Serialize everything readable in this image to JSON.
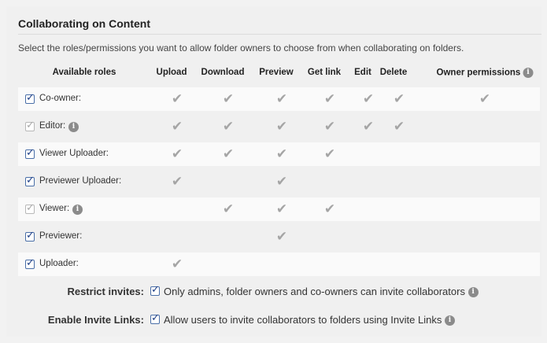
{
  "section": {
    "title": "Collaborating on Content",
    "description": "Select the roles/permissions you want to allow folder owners to choose from when collaborating on folders."
  },
  "columns": [
    "Available roles",
    "Upload",
    "Download",
    "Preview",
    "Get link",
    "Edit",
    "Delete",
    "Owner permissions"
  ],
  "roles": [
    {
      "label": "Co-owner:",
      "checked": true,
      "disabled": false,
      "info": false,
      "perms": [
        true,
        true,
        true,
        true,
        true,
        true,
        true
      ]
    },
    {
      "label": "Editor:",
      "checked": true,
      "disabled": true,
      "info": true,
      "perms": [
        true,
        true,
        true,
        true,
        true,
        true,
        false
      ]
    },
    {
      "label": "Viewer Uploader:",
      "checked": true,
      "disabled": false,
      "info": false,
      "perms": [
        true,
        true,
        true,
        true,
        false,
        false,
        false
      ]
    },
    {
      "label": "Previewer Uploader:",
      "checked": true,
      "disabled": false,
      "info": false,
      "perms": [
        true,
        false,
        true,
        false,
        false,
        false,
        false
      ]
    },
    {
      "label": "Viewer:",
      "checked": true,
      "disabled": true,
      "info": true,
      "perms": [
        false,
        true,
        true,
        true,
        false,
        false,
        false
      ]
    },
    {
      "label": "Previewer:",
      "checked": true,
      "disabled": false,
      "info": false,
      "perms": [
        false,
        false,
        true,
        false,
        false,
        false,
        false
      ]
    },
    {
      "label": "Uploader:",
      "checked": true,
      "disabled": false,
      "info": false,
      "perms": [
        true,
        false,
        false,
        false,
        false,
        false,
        false
      ]
    }
  ],
  "options": {
    "restrict_label": "Restrict invites:",
    "restrict_text": "Only admins, folder owners and co-owners can invite collaborators",
    "restrict_checked": true,
    "invite_label": "Enable Invite Links:",
    "invite_text": "Allow users to invite collaborators to folders using Invite Links",
    "invite_checked": true
  },
  "icons": {
    "check": "checkmark-icon",
    "info": "info-icon"
  }
}
